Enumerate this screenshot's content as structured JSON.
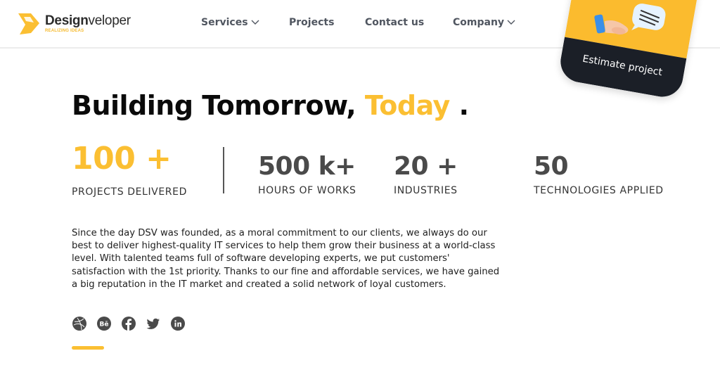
{
  "brand": {
    "name_bold": "Design",
    "name_regular": "veloper",
    "tagline": "REALIZING IDEAS",
    "accent_color": "#fbbf32",
    "dark_color": "#1b1f27"
  },
  "nav": {
    "items": [
      {
        "label": "Services",
        "has_dropdown": true
      },
      {
        "label": "Projects",
        "has_dropdown": false
      },
      {
        "label": "Contact us",
        "has_dropdown": false
      },
      {
        "label": "Company",
        "has_dropdown": true
      }
    ]
  },
  "cta": {
    "label": "Estimate project",
    "icon": "hand-speech-bubble-icon"
  },
  "hero": {
    "headline_main": "Building Tomorrow,",
    "headline_accent": "Today",
    "headline_end": "."
  },
  "stats": [
    {
      "value": "100 +",
      "label": "PROJECTS DELIVERED"
    },
    {
      "value": "500 k+",
      "label": "HOURS OF WORKS"
    },
    {
      "value": "20 +",
      "label": "INDUSTRIES"
    },
    {
      "value": "50",
      "label": "TECHNOLOGIES APPLIED"
    }
  ],
  "description": "Since the day DSV was founded, as a moral commitment to our clients, we always do our best to deliver highest-quality IT services to help them grow their business at a world-class level. With talented teams full of software developing experts, we put customers' satisfaction with the 1st priority. Thanks to our fine and affordable services, we have gained a big reputation in the IT market and created a solid network of loyal customers.",
  "socials": [
    {
      "name": "dribbble",
      "icon": "dribbble-icon"
    },
    {
      "name": "behance",
      "icon": "behance-icon"
    },
    {
      "name": "facebook",
      "icon": "facebook-icon"
    },
    {
      "name": "twitter",
      "icon": "twitter-icon"
    },
    {
      "name": "linkedin",
      "icon": "linkedin-icon"
    }
  ]
}
